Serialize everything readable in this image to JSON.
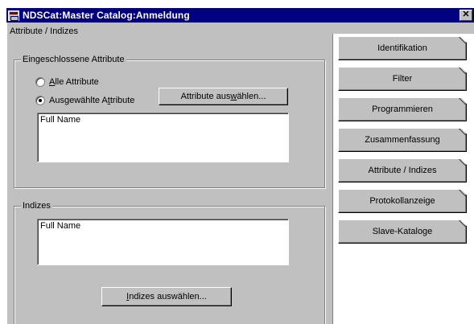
{
  "window": {
    "title": "NDSCat:Master Catalog:Anmeldung",
    "close_symbol": "✕"
  },
  "breadcrumb": "Attribute / Indizes",
  "attributes_group": {
    "legend": "Eingeschlossene Attribute",
    "radio_all": {
      "pre": "",
      "mn": "A",
      "post": "lle Attribute",
      "selected": false
    },
    "radio_selected": {
      "pre": "Ausgewählte A",
      "mn": "t",
      "post": "tribute",
      "selected": true
    },
    "select_button": {
      "pre": "Attribute aus",
      "mn": "w",
      "post": "ählen..."
    },
    "list": [
      "Full Name"
    ]
  },
  "indexes_group": {
    "legend": "Indizes",
    "list": [
      "Full Name"
    ],
    "select_button": {
      "pre": "",
      "mn": "I",
      "post": "ndizes auswählen..."
    }
  },
  "tabs": [
    {
      "label": "Identifikation"
    },
    {
      "label": "Filter"
    },
    {
      "label": "Programmieren"
    },
    {
      "label": "Zusammenfassung"
    },
    {
      "label": "Attribute / Indizes"
    },
    {
      "label": "Protokollanzeige"
    },
    {
      "label": "Slave-Kataloge"
    }
  ],
  "colors": {
    "titlebar": "#000080",
    "face": "#c0c0c0"
  }
}
